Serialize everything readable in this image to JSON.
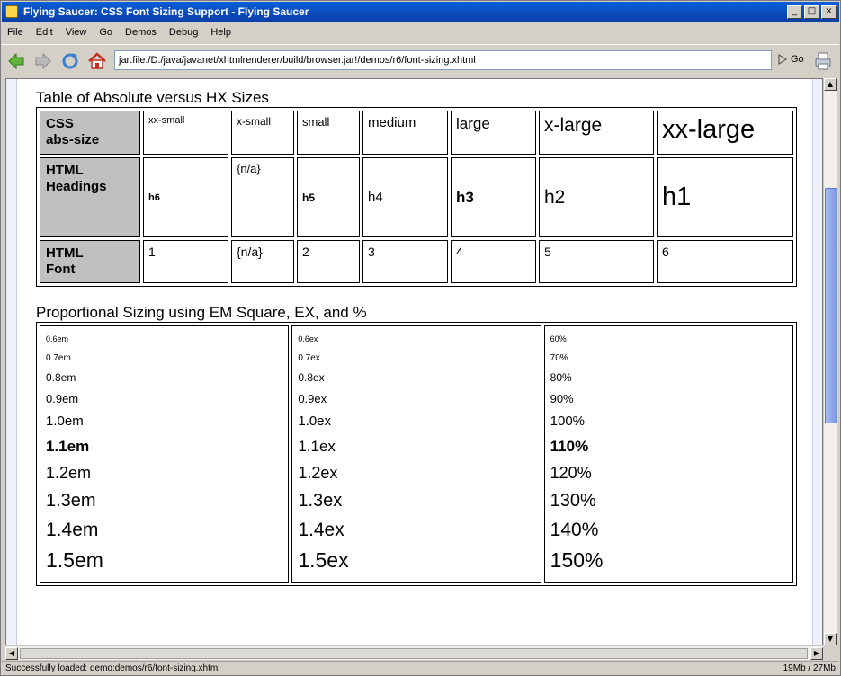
{
  "window": {
    "title": "Flying Saucer: CSS Font Sizing Support - Flying Saucer",
    "buttons": [
      "_",
      "□",
      "×"
    ]
  },
  "menu": [
    "File",
    "Edit",
    "View",
    "Go",
    "Demos",
    "Debug",
    "Help"
  ],
  "toolbar": {
    "back_icon": "back-arrow-icon",
    "forward_icon": "forward-arrow-icon",
    "reload_icon": "reload-icon",
    "home_icon": "home-icon",
    "url": "jar:file:/D:/java/javanet/xhtmlrenderer/build/browser.jar!/demos/r6/font-sizing.xhtml",
    "go_label": "Go"
  },
  "page": {
    "section1_title": "Table of Absolute versus HX Sizes",
    "table1": {
      "row1_header": [
        "CSS",
        "abs-size"
      ],
      "row1": [
        "xx-small",
        "x-small",
        "small",
        "medium",
        "large",
        "x-large",
        "xx-large"
      ],
      "row2_header": [
        "HTML",
        "Headings"
      ],
      "row2": [
        "h6",
        "{n/a}",
        "h5",
        "h4",
        "h3",
        "h2",
        "h1"
      ],
      "row3_header": [
        "HTML",
        "Font"
      ],
      "row3": [
        "1",
        "{n/a}",
        "2",
        "3",
        "4",
        "5",
        "6"
      ]
    },
    "section2_title": "Proportional Sizing using EM Square, EX, and %",
    "table2": {
      "em": [
        "0.6em",
        "0.7em",
        "0.8em",
        "0.9em",
        "1.0em",
        "1.1em",
        "1.2em",
        "1.3em",
        "1.4em",
        "1.5em"
      ],
      "ex": [
        "0.6ex",
        "0.7ex",
        "0.8ex",
        "0.9ex",
        "1.0ex",
        "1.1ex",
        "1.2ex",
        "1.3ex",
        "1.4ex",
        "1.5ex"
      ],
      "pct": [
        "60%",
        "70%",
        "80%",
        "90%",
        "100%",
        "110%",
        "120%",
        "130%",
        "140%",
        "150%"
      ]
    }
  },
  "status": {
    "left": "Successfully loaded: demo:demos/r6/font-sizing.xhtml",
    "right": "19Mb / 27Mb"
  }
}
